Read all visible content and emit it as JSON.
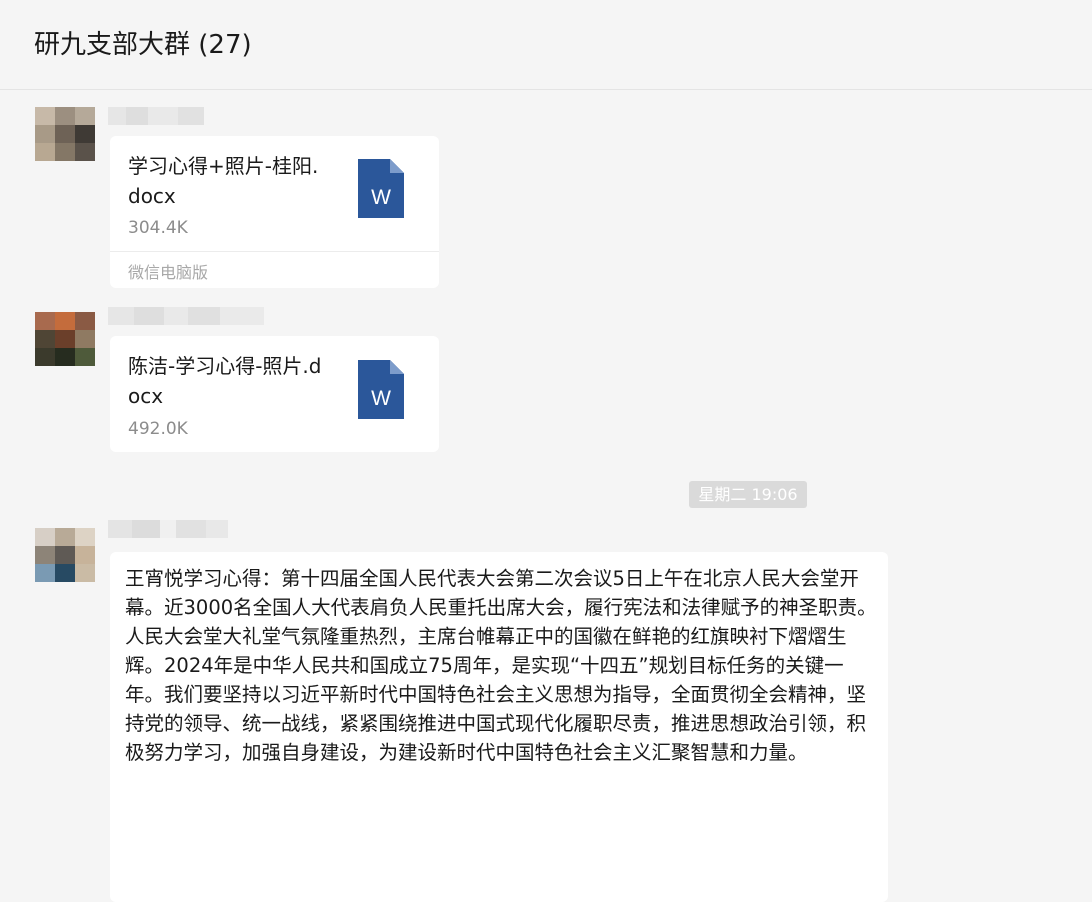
{
  "header": {
    "title": "研九支部大群 (27)"
  },
  "messages": [
    {
      "type": "file",
      "file_name": "学习心得+照片-桂阳.docx",
      "file_size": "304.4K",
      "source": "微信电脑版",
      "file_icon": "word-doc-icon"
    },
    {
      "type": "file",
      "file_name": "陈洁-学习心得-照片.docx",
      "file_size": "492.0K",
      "file_icon": "word-doc-icon"
    },
    {
      "type": "time",
      "text": "星期二 19:06"
    },
    {
      "type": "text",
      "text": "王宵悦学习心得：第十四届全国人民代表大会第二次会议5日上午在北京人民大会堂开幕。近3000名全国人大代表肩负人民重托出席大会，履行宪法和法律赋予的神圣职责。人民大会堂大礼堂气氛隆重热烈，主席台帷幕正中的国徽在鲜艳的红旗映衬下熠熠生辉。2024年是中华人民共和国成立75周年，是实现“十四五”规划目标任务的关键一年。我们要坚持以习近平新时代中国特色社会主义思想为指导，全面贯彻全会精神，坚持党的领导、统一战线，紧紧围绕推进中国式现代化履职尽责，推进思想政治引领，积极努力学习，加强自身建设，为建设新时代中国特色社会主义汇聚智慧和力量。"
    }
  ],
  "colors": {
    "background": "#f5f5f5",
    "bubble": "#ffffff",
    "word_icon": "#2b579a",
    "secondary_text": "#8c8c8c",
    "time_badge": "#dadada"
  }
}
